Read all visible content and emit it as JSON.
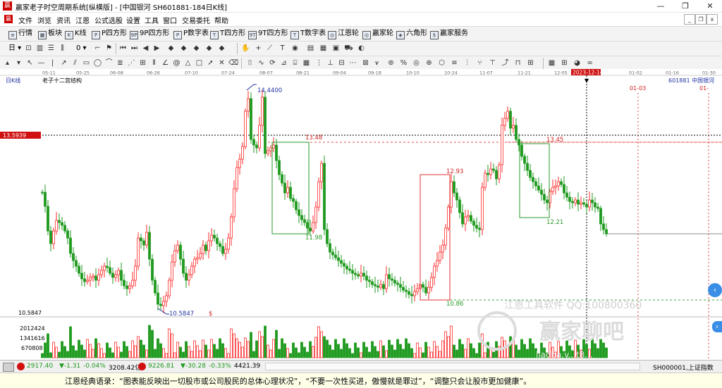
{
  "window": {
    "title": "赢家老子时空周期系统[纵横版] - [中国银河  SH601881-184日K线]",
    "logo_text": "赢",
    "controls": [
      "—",
      "❐",
      "✕"
    ]
  },
  "menu": {
    "items": [
      "文件",
      "浏览",
      "资讯",
      "江恩",
      "公式选股",
      "设置",
      "工具",
      "窗口",
      "交易委托",
      "帮助"
    ],
    "mdi_controls": [
      "_",
      "❐",
      "x"
    ]
  },
  "toolbar1": {
    "items": [
      "行情",
      "板块",
      "K线",
      "P四方形",
      "9P四方形",
      "P数字表",
      "T四方形",
      "9T四方形",
      "T数字表",
      "江恩轮",
      "赢家轮",
      "六角形",
      "赢家服务"
    ],
    "icon_texts": [
      "≡",
      "▦",
      "K",
      "P",
      "9P",
      "P",
      "T",
      "9T",
      "T",
      "◎",
      "◎",
      "◈",
      "$"
    ]
  },
  "toolbar2": {
    "left_select": "日",
    "left_value": "0"
  },
  "chart": {
    "section_label": "日K线",
    "indicator_title": "老子十二宫结构",
    "stock_label": "601881  中国银河",
    "date_labels": [
      "05-11",
      "05-25",
      "06-08",
      "06-26",
      "07-10",
      "07-24",
      "08-07",
      "08-21",
      "09-04",
      "09-18",
      "10-10",
      "10-24",
      "11-07",
      "11-21",
      "12-05",
      "2023-12-14",
      "01-02",
      "01-16",
      "01-30"
    ],
    "cursor_date": "2023-12-14",
    "future_dates": [
      "01-03",
      "01-"
    ],
    "price_readout": "13.5939",
    "y_labels_price": {
      "low": "10.5847"
    },
    "annotations": {
      "high": "14.4400",
      "box1_top": "13.48",
      "box1_bottom": "11.98",
      "box2_top": "12.93",
      "box2_bottom": "10.86",
      "box3_top": "13.45",
      "box3_bottom": "12.21",
      "low": "10.5847",
      "dollar": "$"
    },
    "volume_labels": [
      "2012424",
      "1341616",
      "670808"
    ],
    "watermark": [
      "江恩工具软件  QQ:100800360",
      "赢家聊吧",
      "liaoba.y...t3..."
    ],
    "colors": {
      "up": "#ff2a2a",
      "down": "#1f9a1f",
      "box_red": "#e03030",
      "box_green": "#2a9a2a",
      "blue_text": "#2030a0"
    }
  },
  "status": {
    "idx1_value": "2917.40",
    "idx1_change": "▼-1.31",
    "idx1_pct": "-0.04%",
    "idx1_amount": "3208.42亿",
    "idx2_value": "9226.81",
    "idx2_change": "▼-30.28",
    "idx2_pct": "-0.33%",
    "idx2_amount": "4421.39",
    "right_text": "SH000001,上证指数"
  },
  "footer": {
    "quote": "江恩经典语录：“图表能反映出一切股市或公司股民的总体心理状况”，“不要一次性买进，傲慢就是罪过”，“调整只会让股市更加健康”。"
  },
  "chart_data": {
    "type": "candlestick",
    "title": "老子十二宫结构",
    "series": [
      {
        "name": "中国银河",
        "approx_price_range": [
          10.5847,
          14.44
        ]
      }
    ],
    "key_levels": [
      14.44,
      13.5939,
      13.48,
      13.45,
      12.93,
      12.21,
      11.98,
      10.86,
      10.5847
    ],
    "volume_axis": [
      670808,
      1341616,
      2012424
    ]
  }
}
